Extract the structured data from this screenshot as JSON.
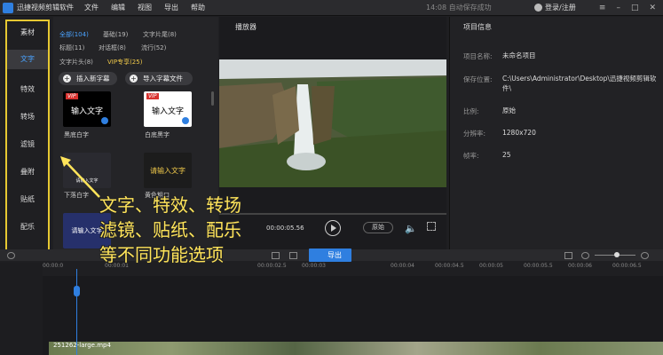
{
  "titlebar": {
    "app_name": "迅捷视频剪辑软件",
    "menu": [
      "文件",
      "编辑",
      "视图",
      "导出",
      "帮助"
    ],
    "status": "14:08 自动保存成功",
    "user": "登录/注册",
    "window_buttons": [
      "≡",
      "–",
      "□",
      "✕"
    ]
  },
  "leftnav": {
    "items": [
      "素材",
      "文字",
      "特效",
      "转场",
      "滤镜",
      "叠附",
      "贴纸",
      "配乐"
    ],
    "active": "文字"
  },
  "filters": {
    "row1": [
      "全部(104)",
      "基础(19)",
      "文字片尾(8)"
    ],
    "row2": [
      "标题(11)",
      "对话框(8)",
      "流行(52)"
    ],
    "row3_a": "文字片头(8)",
    "row3_vip": "VIP专享(25)"
  },
  "buttons": {
    "add_text": "插入新字幕",
    "import_subtitle": "导入字幕文件"
  },
  "thumbnails": [
    {
      "label": "黑底白字",
      "text": "输入文字",
      "vip": "VIP"
    },
    {
      "label": "白底黑字",
      "text": "输入文字",
      "vip": "VIP"
    },
    {
      "label": "下落白字",
      "text": "请输入文字"
    },
    {
      "label": "黄色粗口",
      "text": "请输入文字"
    },
    {
      "label": "",
      "text": "请输入文字"
    }
  ],
  "player": {
    "title": "播放器",
    "time": "00:00:05.56",
    "quality": "原始"
  },
  "info": {
    "title": "项目信息",
    "rows": [
      {
        "label": "项目名称:",
        "value": "未命名项目"
      },
      {
        "label": "保存位置:",
        "value": "C:\\Users\\Administrator\\Desktop\\迅捷视频剪辑软件\\"
      },
      {
        "label": "比例:",
        "value": "原始"
      },
      {
        "label": "分辨率:",
        "value": "1280x720"
      },
      {
        "label": "帧率:",
        "value": "25"
      }
    ]
  },
  "toolbar": {
    "export_label": "导出"
  },
  "ruler_ticks": [
    "00:00:0",
    "00:00:01",
    "00:00:02.5",
    "00:00:03",
    "00:00:04",
    "00:00:04.5",
    "00:00:05",
    "00:00:05.5",
    "00:00:06",
    "00:00:06.5"
  ],
  "clip": {
    "name": "251262-large.mp4"
  },
  "callout": {
    "line1": "文字、特效、转场",
    "line2": "滤镜、贴纸、配乐",
    "line3": "等不同功能选项"
  },
  "colors": {
    "accent": "#2f7fe0",
    "highlight": "#e6c832",
    "vip": "#f0c94a"
  }
}
